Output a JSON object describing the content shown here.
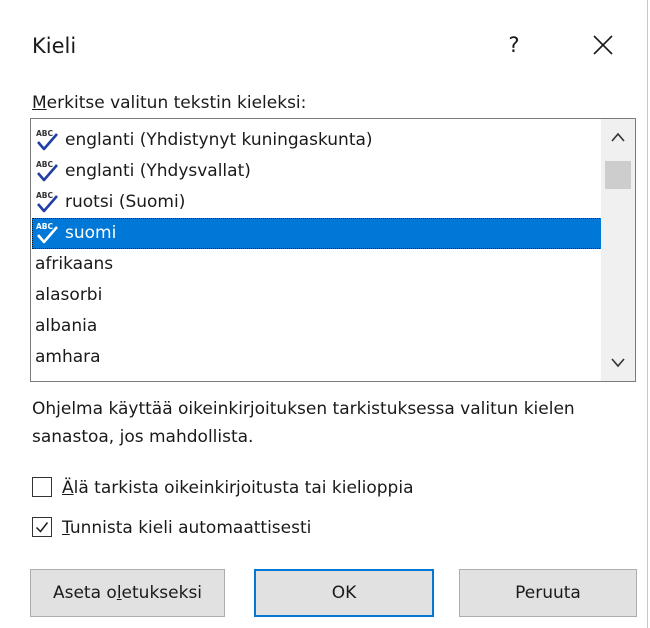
{
  "dialog": {
    "title": "Kieli",
    "help_label": "?"
  },
  "prompt": {
    "text_prefix": "",
    "underlined_char": "M",
    "text_rest": "erkitse valitun tekstin kieleksi:"
  },
  "languages": [
    {
      "label": "englanti (Yhdistynyt kuningaskunta)",
      "spellcheck": true,
      "selected": false
    },
    {
      "label": "englanti (Yhdysvallat)",
      "spellcheck": true,
      "selected": false
    },
    {
      "label": "ruotsi (Suomi)",
      "spellcheck": true,
      "selected": false
    },
    {
      "label": "suomi",
      "spellcheck": true,
      "selected": true
    },
    {
      "label": "afrikaans",
      "spellcheck": false,
      "selected": false
    },
    {
      "label": "alasorbi",
      "spellcheck": false,
      "selected": false
    },
    {
      "label": "albania",
      "spellcheck": false,
      "selected": false
    },
    {
      "label": "amhara",
      "spellcheck": false,
      "selected": false
    }
  ],
  "info_text": "Ohjelma käyttää oikeinkirjoituksen tarkistuksessa valitun kielen sanastoa, jos mahdollista.",
  "checkboxes": {
    "no_proofing": {
      "underlined_char": "Ä",
      "text_rest": "lä tarkista oikeinkirjoitusta tai kielioppia",
      "checked": false
    },
    "detect_language": {
      "underlined_char": "T",
      "text_rest": "unnista kieli automaattisesti",
      "checked": true
    }
  },
  "buttons": {
    "set_default": {
      "text_before": "Aseta o",
      "underlined_char": "l",
      "text_after": "etukseksi"
    },
    "ok": "OK",
    "cancel": "Peruuta"
  },
  "colors": {
    "selection": "#0078d7",
    "button_face": "#e1e1e1",
    "spell_icon_check": "#1f3fa6"
  }
}
